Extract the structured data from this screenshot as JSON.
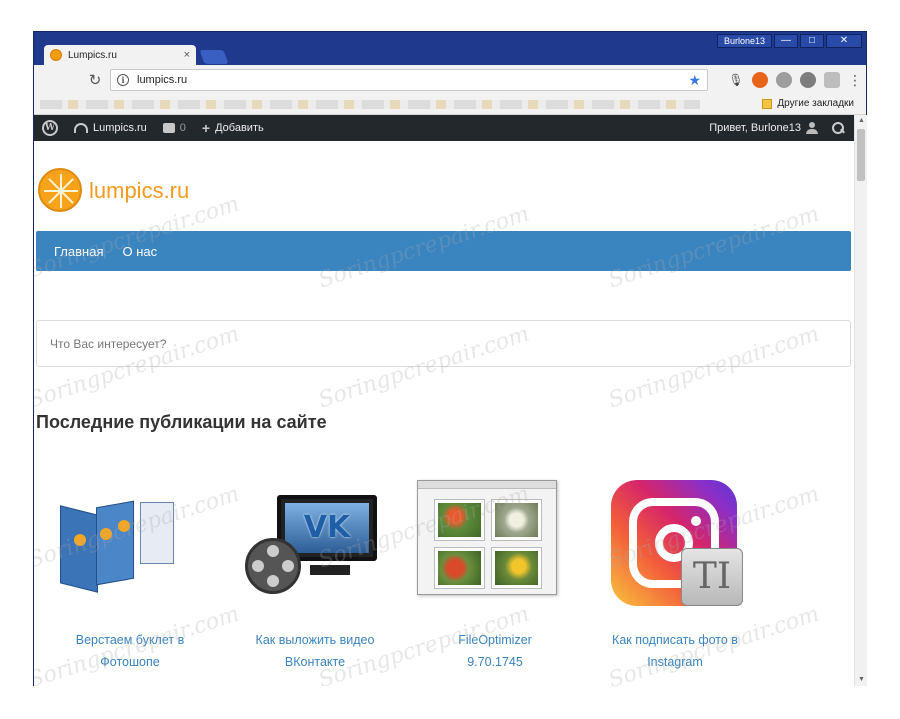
{
  "window": {
    "profile": "Burlone13",
    "controls": {
      "minimize": "—",
      "maximize": "□",
      "close": "✕"
    }
  },
  "tab": {
    "title": "Lumpics.ru",
    "close": "×"
  },
  "toolbar": {
    "url": "lumpics.ru",
    "icons": [
      "reload-icon",
      "info-icon",
      "star-icon",
      "mic-icon",
      "extension-icons",
      "menu-icon"
    ]
  },
  "bookmarks": {
    "other_label": "Другие закладки"
  },
  "adminbar": {
    "site_name": "Lumpics.ru",
    "comments_count": "0",
    "add_label": "Добавить",
    "greeting": "Привет, Burlone13"
  },
  "site": {
    "title": "lumpics.ru",
    "nav": [
      "Главная",
      "О нас"
    ],
    "search_placeholder": "Что Вас интересует?",
    "section_title": "Последние публикации на сайте"
  },
  "posts": [
    {
      "line1": "Верстаем буклет в",
      "line2": "Фотошопе"
    },
    {
      "line1": "Как выложить видео",
      "line2": "ВКонтакте"
    },
    {
      "line1": "FileOptimizer",
      "line2": "9.70.1745"
    },
    {
      "line1": "Как подписать фото в",
      "line2": "Instagram"
    }
  ],
  "thumb_text": {
    "vk": "VK",
    "ti": "TI"
  },
  "watermark_text": "Soringpcrepair.com",
  "colors": {
    "accent": "#3a84c0",
    "brand": "#f39a1f",
    "adminbar": "#23282d",
    "frame": "#1f3a8c"
  }
}
